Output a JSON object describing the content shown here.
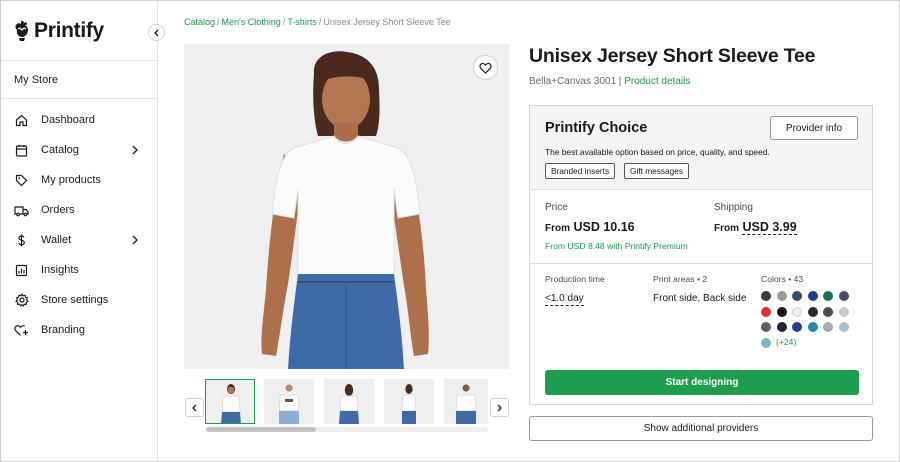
{
  "brand": {
    "name": "Printify"
  },
  "sidebar": {
    "store": "My Store",
    "items": [
      {
        "label": "Dashboard",
        "icon": "home-icon",
        "chevron": false
      },
      {
        "label": "Catalog",
        "icon": "clipboard-icon",
        "chevron": true
      },
      {
        "label": "My products",
        "icon": "tag-icon",
        "chevron": false
      },
      {
        "label": "Orders",
        "icon": "truck-icon",
        "chevron": false
      },
      {
        "label": "Wallet",
        "icon": "dollar-icon",
        "chevron": true
      },
      {
        "label": "Insights",
        "icon": "chart-icon",
        "chevron": false
      },
      {
        "label": "Store settings",
        "icon": "gear-icon",
        "chevron": false
      },
      {
        "label": "Branding",
        "icon": "heart-plus-icon",
        "chevron": false
      }
    ]
  },
  "breadcrumb": {
    "items": [
      "Catalog",
      "Men's Clothing",
      "T-shirts"
    ],
    "current": "Unisex Jersey Short Sleeve Tee",
    "separator": "/"
  },
  "product": {
    "title": "Unisex Jersey Short Sleeve Tee",
    "brand_model": "Bella+Canvas 3001",
    "divider": "|",
    "details_link": "Product details"
  },
  "provider": {
    "name": "Printify Choice",
    "description": "The best available option based on price, quality, and speed.",
    "tags": [
      "Branded inserts",
      "Gift messages"
    ],
    "info_button": "Provider info",
    "price_label": "Price",
    "from_label": "From",
    "price": "USD 10.16",
    "premium": "From USD 8.48 with Printify Premium",
    "shipping_label": "Shipping",
    "shipping": "USD 3.99",
    "production_label": "Production time",
    "production": "<1.0 day",
    "print_areas_label": "Print areas • 2",
    "print_areas": "Front side, Back side",
    "colors_label": "Colors • 43",
    "colors": [
      "#3a3a3a",
      "#9a9a9a",
      "#3d4a6b",
      "#1f3f8f",
      "#1d6e55",
      "#4a4a6a",
      "#d8333a",
      "#141414",
      "#f2f2f2",
      "#2a2a2a",
      "#4d4d4d",
      "#c9c9c9",
      "#5a5f66",
      "#1d2438",
      "#253f96",
      "#2c85a8",
      "#a9aab0",
      "#a6bfd6",
      "#7bb7c4"
    ],
    "more_colors": "(+24)",
    "start_button": "Start designing"
  },
  "more_providers_button": "Show additional providers",
  "colors": {
    "accent": "#1c9b4c",
    "button": "#1f9d4f"
  }
}
